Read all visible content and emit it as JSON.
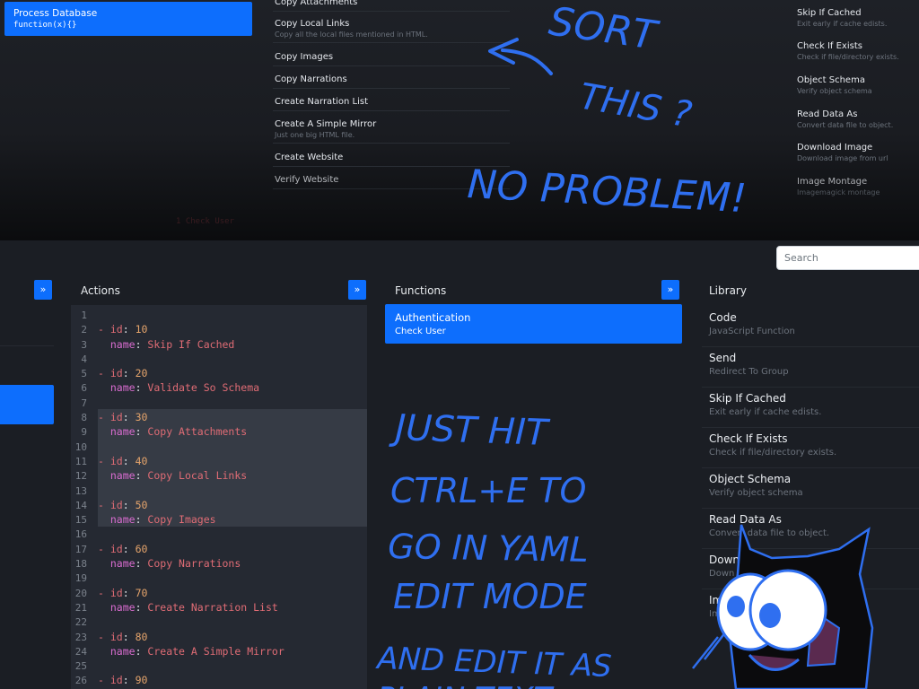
{
  "top_panel": {
    "active_item": {
      "title": "Process Database",
      "subtitle": "function(x){}"
    },
    "middle_list": [
      {
        "title": "Copy Attachments",
        "subtitle": ""
      },
      {
        "title": "Copy Local Links",
        "subtitle": "Copy all the local files mentioned in HTML."
      },
      {
        "title": "Copy Images",
        "subtitle": ""
      },
      {
        "title": "Copy Narrations",
        "subtitle": ""
      },
      {
        "title": "Create Narration List",
        "subtitle": ""
      },
      {
        "title": "Create A Simple Mirror",
        "subtitle": "Just one big HTML file."
      },
      {
        "title": "Create Website",
        "subtitle": ""
      },
      {
        "title": "Verify Website",
        "subtitle": ""
      }
    ],
    "right_list": [
      {
        "title": "Skip If Cached",
        "subtitle": "Exit early if cache edists."
      },
      {
        "title": "Check If Exists",
        "subtitle": "Check if file/directory exists."
      },
      {
        "title": "Object Schema",
        "subtitle": "Verify object schema"
      },
      {
        "title": "Read Data As",
        "subtitle": "Convert data file to object."
      },
      {
        "title": "Download Image",
        "subtitle": "Download image from url"
      },
      {
        "title": "Image Montage",
        "subtitle": "Imagemagick montage"
      }
    ],
    "ghost_text": "1  Check User"
  },
  "search": {
    "placeholder": "Search"
  },
  "columns": {
    "actions": {
      "title": "Actions",
      "expand": "»"
    },
    "functions": {
      "title": "Functions",
      "expand": "»"
    },
    "library": {
      "title": "Library"
    },
    "left_expand": "»"
  },
  "editor": {
    "lines": [
      {
        "n": "1"
      },
      {
        "n": "2",
        "id": "10"
      },
      {
        "n": "3",
        "name": "Skip If Cached"
      },
      {
        "n": "4"
      },
      {
        "n": "5",
        "id": "20"
      },
      {
        "n": "6",
        "name": "Validate So Schema"
      },
      {
        "n": "7"
      },
      {
        "n": "8",
        "id": "30"
      },
      {
        "n": "9",
        "name": "Copy Attachments"
      },
      {
        "n": "10"
      },
      {
        "n": "11",
        "id": "40"
      },
      {
        "n": "12",
        "name": "Copy Local Links"
      },
      {
        "n": "13"
      },
      {
        "n": "14",
        "id": "50"
      },
      {
        "n": "15",
        "name": "Copy Images"
      },
      {
        "n": "16"
      },
      {
        "n": "17",
        "id": "60"
      },
      {
        "n": "18",
        "name": "Copy Narrations"
      },
      {
        "n": "19"
      },
      {
        "n": "20",
        "id": "70"
      },
      {
        "n": "21",
        "name": "Create Narration List"
      },
      {
        "n": "22"
      },
      {
        "n": "23",
        "id": "80"
      },
      {
        "n": "24",
        "name": "Create A Simple Mirror"
      },
      {
        "n": "25"
      },
      {
        "n": "26",
        "id": "90"
      }
    ],
    "id_key": "id",
    "name_key": "name"
  },
  "functions": {
    "active_item": {
      "title": "Authentication",
      "subtitle": "Check User"
    }
  },
  "library": [
    {
      "title": "Code",
      "subtitle": "JavaScript Function"
    },
    {
      "title": "Send",
      "subtitle": "Redirect To Group"
    },
    {
      "title": "Skip If Cached",
      "subtitle": "Exit early if cache edists."
    },
    {
      "title": "Check If Exists",
      "subtitle": "Check if file/directory exists."
    },
    {
      "title": "Object Schema",
      "subtitle": "Verify object schema"
    },
    {
      "title": "Read Data As",
      "subtitle": "Convert data file to object."
    },
    {
      "title": "Down",
      "subtitle": "Down"
    },
    {
      "title": "Im",
      "subtitle": "Im"
    }
  ],
  "handwriting": {
    "top_note": [
      "SORT",
      "THIS ?",
      "NO PROBLEM!"
    ],
    "bottom_note": [
      "JUST HIT",
      "CTRL+E TO",
      "GO IN YAML",
      "EDIT MODE",
      "AND EDIT IT AS",
      "PLAIN TEXT"
    ]
  },
  "colors": {
    "accent": "#0d6efd",
    "ink": "#2f6ff0",
    "background": "#1b1e24",
    "editor_bg": "#252932"
  }
}
